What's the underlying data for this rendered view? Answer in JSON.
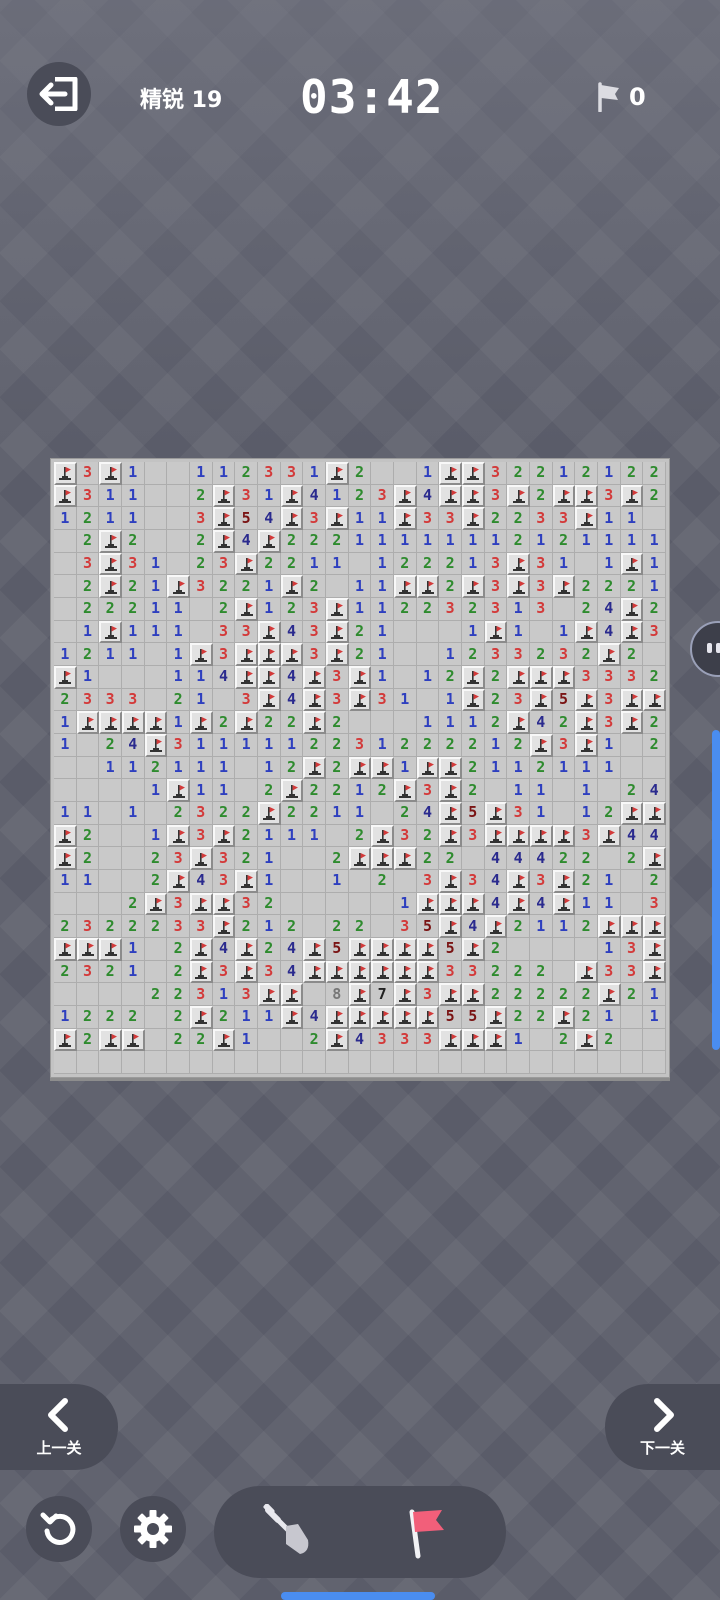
{
  "header": {
    "level_label": "精锐 19",
    "timer": "03:42",
    "flags_placed": "0"
  },
  "icons": {
    "exit": "exit-door-icon",
    "flag_counter": "flag-icon",
    "prev": "chevron-left-icon",
    "next": "chevron-right-icon",
    "restart": "restart-icon",
    "settings": "gear-icon",
    "dig_tool": "shovel-icon",
    "flag_tool": "flag-icon"
  },
  "colors": {
    "number_1": "#2e3fbf",
    "number_2": "#2e8b2e",
    "number_3": "#d33a3a",
    "number_4": "#2a2a8e",
    "number_5": "#7a1414",
    "mine_flag": "#d33a3a",
    "accent": "#4a8df0"
  },
  "board": {
    "columns": 27,
    "rows": 27,
    "legend": "M = revealed flagged mine, digits = adjacent mine count, '.' = empty revealed cell",
    "grid": [
      "M3M1..112331M2..1MM322121222M1",
      "M311..2M31M4123M4MM3M2MM3M21",
      "1211..3M54M3M11M33M2233M11.",
      ".2M2..2M4M222111111121211111",
      ".3M31.23M2211.122213M31.1M1",
      ".2M21M3221M2.11MM2M3M3M2221",
      ".22211.2M123M112232313.24M2",
      ".1M111.33M43M21...1M1.1M4M3",
      "1211.1M3MMM3M21..1233232M2",
      "M1...114MM4M3M1.12M2MMM3332",
      "2333.21.3M4M3M31.1M23M5M3MM1",
      "1MMMM1M2M22M2...1112M42M3M21",
      "1.24M3111112231222212M3M1.2M3",
      "..112111.12M2MM1MM2112111..3MM",
      "....1M11.2M2212M3M2.11.1.24MM",
      "11.1.2322M2211.24M5M31.12MM43",
      "M2..1M3M2111.2M32M3MMMM3M44.5M2",
      "M2..23M321..2MMM22.44422.2MM4M3",
      "11..2M43M1..1.2.3M34M3M21.23M5M4M",
      "...2M3MM32.....1MMM4M4M11.31M4M31",
      "2322233M212.22.35M4M2112MMM4M11",
      "MMM1.2M4M24M5MMMM5M2....13MMM3.1",
      "2321.2M3M34MMMMMM33222.M33M21",
      "....22313MM.8M7M3MM22222M21",
      "1222.2M211M4MMMMM55M22M21.13M",
      "M2MM.22M1..2M4333MMM1.2M2....2M"
    ]
  }
}
